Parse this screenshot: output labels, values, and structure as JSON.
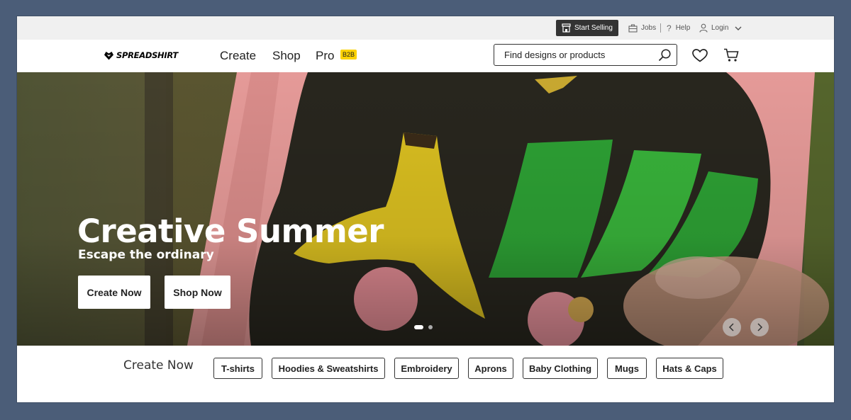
{
  "utility_bar": {
    "start_selling": "Start Selling",
    "jobs": "Jobs",
    "help": "Help",
    "login": "Login",
    "icons": [
      "store-icon",
      "briefcase-icon",
      "question-icon",
      "user-icon",
      "chevron-down-icon"
    ]
  },
  "header": {
    "logo_text": "SPREADSHIRT",
    "nav": [
      {
        "label": "Create"
      },
      {
        "label": "Shop"
      },
      {
        "label": "Pro"
      }
    ],
    "pro_badge": "B2B",
    "search_placeholder": "Find designs or products",
    "icons": [
      "search-icon",
      "heart-icon",
      "cart-icon"
    ]
  },
  "hero": {
    "title": "Creative Summer",
    "subtitle": "Escape the ordinary",
    "buttons": [
      {
        "label": "Create Now"
      },
      {
        "label": "Shop Now"
      }
    ],
    "slides_count": 2,
    "active_slide": 1
  },
  "categories": {
    "heading": "Create Now",
    "items": [
      {
        "label": "T-shirts"
      },
      {
        "label": "Hoodies & Sweatshirts"
      },
      {
        "label": "Embroidery"
      },
      {
        "label": "Aprons"
      },
      {
        "label": "Baby Clothing"
      },
      {
        "label": "Mugs"
      },
      {
        "label": "Hats & Caps"
      }
    ]
  },
  "colors": {
    "page_background": "#4b5d78",
    "utility_bar": "#f0f0f0",
    "start_selling_bg": "#333333",
    "b2b_badge": "#fbd200"
  }
}
